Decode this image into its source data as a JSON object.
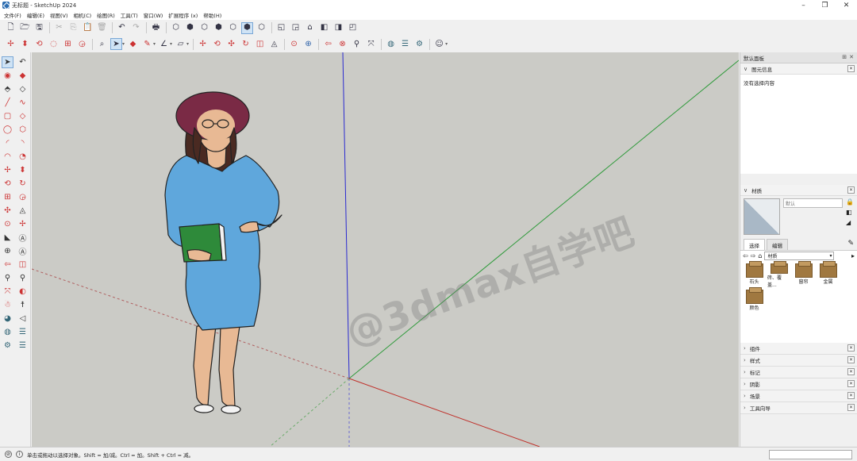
{
  "window": {
    "title": "无标题 - SketchUp 2024"
  },
  "menu": [
    "文件(F)",
    "编辑(E)",
    "视图(V)",
    "相机(C)",
    "绘图(R)",
    "工具(T)",
    "窗口(W)",
    "扩展程序 (x)",
    "帮助(H)"
  ],
  "toolbar1": [
    "new-file-icon",
    "open-file-icon",
    "save-icon",
    "sep",
    "cut-icon",
    "copy-icon",
    "paste-icon",
    "erase-icon",
    "sep",
    "undo-icon",
    "redo-icon",
    "sep",
    "print-icon",
    "sep",
    "iso-view-icon",
    "top-view-icon",
    "front-view-icon",
    "right-view-icon",
    "back-view-icon",
    "left-view-icon",
    "sep",
    "xray-icon",
    "wireframe-icon",
    "hidden-line-icon",
    "shaded-icon",
    "shaded-textures-icon",
    "monochrome-icon"
  ],
  "toolbar2_glyphs": [
    "✢",
    "✣",
    "⟲",
    "⊞",
    "↻",
    "⌕",
    "➤",
    "◆",
    "✎",
    "∠",
    "▱",
    "✢",
    "⟲",
    "✣",
    "◫",
    "⚲",
    "◬",
    "⊙",
    "⊕",
    "✎",
    "⊗",
    "⊘",
    "⚙",
    "☰",
    "◍",
    "⊚"
  ],
  "entity_info": {
    "header": "默认面板",
    "title": "图元信息",
    "body": "没有选择内容"
  },
  "materials": {
    "title": "材质",
    "name_value": "默认",
    "tab_select": "选择",
    "tab_edit": "编辑",
    "library": "材质",
    "items": [
      "石头",
      "砖、覆盖...",
      "窗帘",
      "金属",
      "颜色"
    ]
  },
  "collapsed_panels": [
    "组件",
    "样式",
    "标记",
    "阴影",
    "场景",
    "工具向导"
  ],
  "status": {
    "text": "单击或拖动以选择对象。Shift = 加/减。Ctrl = 加。Shift + Ctrl = 减。"
  },
  "watermark": "@3dmax自学吧",
  "colors": {
    "viewport": "#cbcbc6",
    "axis_red": "#c0302a",
    "axis_green": "#2e9a3a",
    "axis_blue": "#2a2ad0",
    "dress": "#5fa7dc",
    "hat": "#7a2a45"
  }
}
